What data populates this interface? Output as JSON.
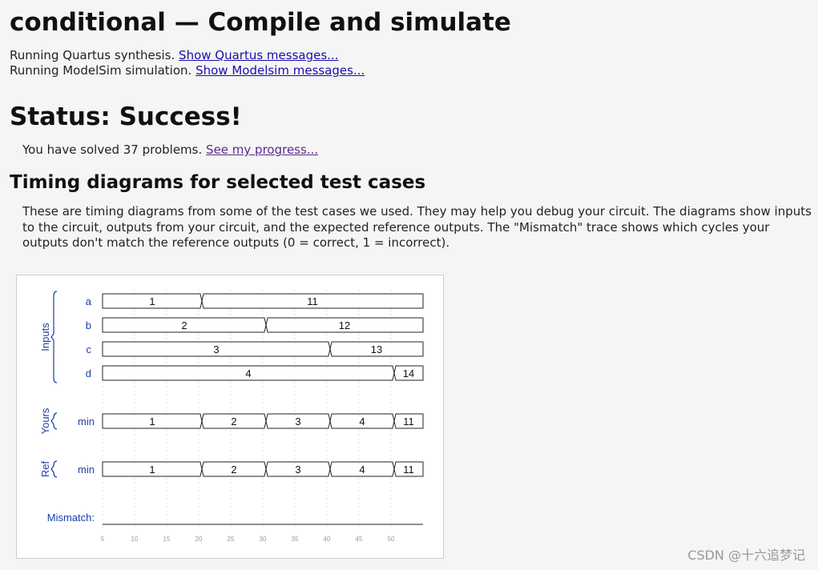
{
  "header": {
    "title": "conditional — Compile and simulate"
  },
  "messages": [
    {
      "text": "Running Quartus synthesis.",
      "link": "Show Quartus messages..."
    },
    {
      "text": "Running ModelSim simulation.",
      "link": "Show Modelsim messages..."
    }
  ],
  "status": {
    "title": "Status: Success!"
  },
  "progress": {
    "text": "You have solved 37 problems.",
    "link": "See my progress..."
  },
  "timing": {
    "heading": "Timing diagrams for selected test cases",
    "description": "These are timing diagrams from some of the test cases we used. They may help you debug your circuit. The diagrams show inputs to the circuit, outputs from your circuit, and the expected reference outputs. The \"Mismatch\" trace shows which cycles your outputs don't match the reference outputs (0 = correct, 1 = incorrect)."
  },
  "chart_data": {
    "type": "timing",
    "groups": [
      "Inputs",
      "Yours",
      "Ref"
    ],
    "time_ticks": [
      5,
      10,
      15,
      20,
      25,
      30,
      35,
      40,
      45,
      50
    ],
    "time_range": [
      5,
      55
    ],
    "signals": [
      {
        "name": "a",
        "group": "Inputs",
        "segments": [
          {
            "from": 5,
            "to": 20.5,
            "value": "1"
          },
          {
            "from": 20.5,
            "to": 55,
            "value": "11"
          }
        ]
      },
      {
        "name": "b",
        "group": "Inputs",
        "segments": [
          {
            "from": 5,
            "to": 30.5,
            "value": "2"
          },
          {
            "from": 30.5,
            "to": 55,
            "value": "12"
          }
        ]
      },
      {
        "name": "c",
        "group": "Inputs",
        "segments": [
          {
            "from": 5,
            "to": 40.5,
            "value": "3"
          },
          {
            "from": 40.5,
            "to": 55,
            "value": "13"
          }
        ]
      },
      {
        "name": "d",
        "group": "Inputs",
        "segments": [
          {
            "from": 5,
            "to": 50.5,
            "value": "4"
          },
          {
            "from": 50.5,
            "to": 55,
            "value": "14"
          }
        ]
      },
      {
        "name": "min",
        "group": "Yours",
        "segments": [
          {
            "from": 5,
            "to": 20.5,
            "value": "1"
          },
          {
            "from": 20.5,
            "to": 30.5,
            "value": "2"
          },
          {
            "from": 30.5,
            "to": 40.5,
            "value": "3"
          },
          {
            "from": 40.5,
            "to": 50.5,
            "value": "4"
          },
          {
            "from": 50.5,
            "to": 55,
            "value": "11"
          }
        ]
      },
      {
        "name": "min",
        "group": "Ref",
        "segments": [
          {
            "from": 5,
            "to": 20.5,
            "value": "1"
          },
          {
            "from": 20.5,
            "to": 30.5,
            "value": "2"
          },
          {
            "from": 30.5,
            "to": 40.5,
            "value": "3"
          },
          {
            "from": 40.5,
            "to": 50.5,
            "value": "4"
          },
          {
            "from": 50.5,
            "to": 55,
            "value": "11"
          }
        ]
      }
    ],
    "mismatch": {
      "label": "Mismatch:",
      "mismatches": []
    }
  },
  "watermark": "CSDN @十六追梦记"
}
